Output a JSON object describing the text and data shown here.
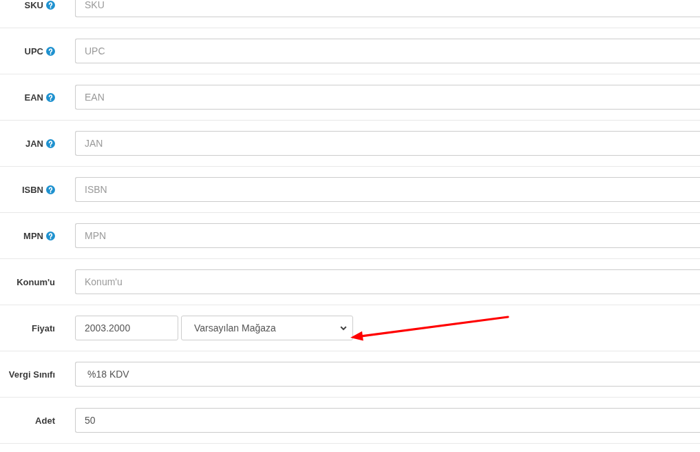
{
  "fields": [
    {
      "label": "SKU",
      "help": true,
      "kind": "text",
      "placeholder": "SKU"
    },
    {
      "label": "UPC",
      "help": true,
      "kind": "text",
      "placeholder": "UPC"
    },
    {
      "label": "EAN",
      "help": true,
      "kind": "text",
      "placeholder": "EAN"
    },
    {
      "label": "JAN",
      "help": true,
      "kind": "text",
      "placeholder": "JAN"
    },
    {
      "label": "ISBN",
      "help": true,
      "kind": "text",
      "placeholder": "ISBN"
    },
    {
      "label": "MPN",
      "help": true,
      "kind": "text",
      "placeholder": "MPN"
    },
    {
      "label": "Konum'u",
      "help": false,
      "kind": "text",
      "placeholder": "Konum'u"
    },
    {
      "label": "Fiyatı",
      "help": false,
      "kind": "price",
      "value": "2003.2000",
      "select": {
        "value": "Varsayılan Mağaza"
      }
    },
    {
      "label": "Vergi Sınıfı",
      "help": false,
      "kind": "select",
      "value": "%18 KDV"
    },
    {
      "label": "Adet",
      "help": false,
      "kind": "text",
      "value": "50"
    }
  ]
}
